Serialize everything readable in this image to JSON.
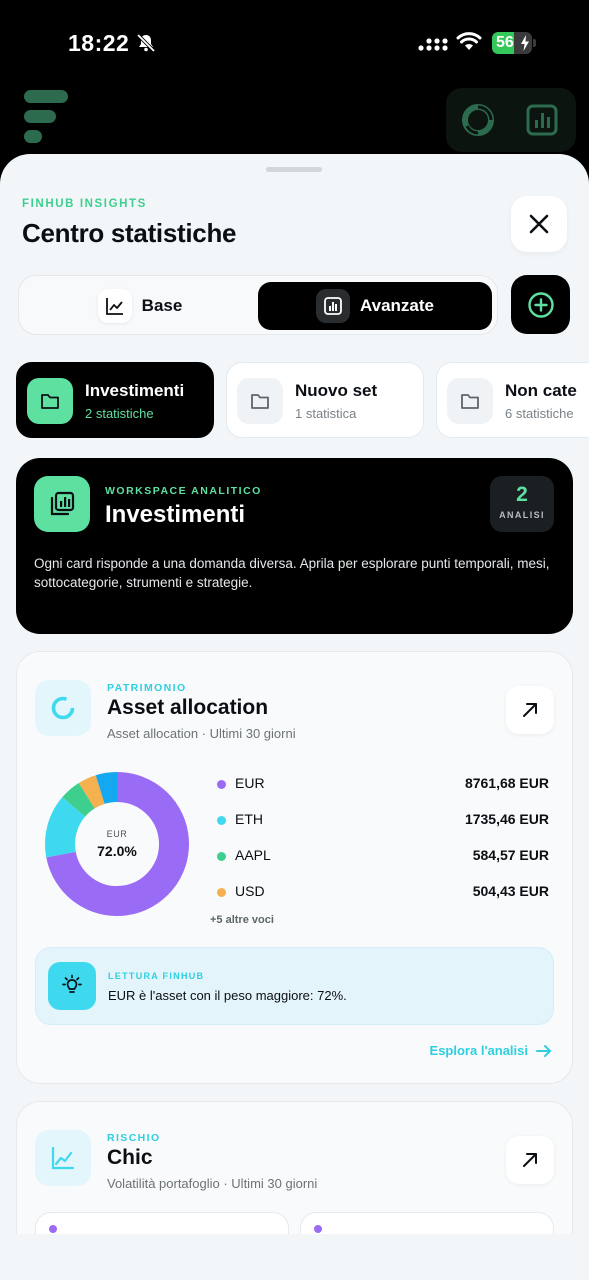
{
  "status_bar": {
    "time": "18:22",
    "battery": "56",
    "battery_level": 0.56
  },
  "header": {
    "eyebrow": "FINHUB INSIGHTS",
    "title": "Centro statistiche"
  },
  "mode_tabs": [
    {
      "label": "Base",
      "active": false
    },
    {
      "label": "Avanzate",
      "active": true
    }
  ],
  "sets": [
    {
      "name": "Investimenti",
      "count": "2 statistiche",
      "active": true
    },
    {
      "name": "Nuovo set",
      "count": "1 statistica",
      "active": false
    },
    {
      "name": "Non cate",
      "count": "6 statistiche",
      "active": false
    }
  ],
  "workspace": {
    "eyebrow": "WORKSPACE ANALITICO",
    "title": "Investimenti",
    "count": "2",
    "count_label": "ANALISI",
    "description": "Ogni card risponde a una domanda diversa. Aprila per esplorare punti temporali, mesi, sottocategorie, strumenti e strategie."
  },
  "asset_card": {
    "eyebrow": "PATRIMONIO",
    "title": "Asset allocation",
    "subtitle": "Asset allocation · Ultimi 30 giorni",
    "center_label": "EUR",
    "center_value": "72.0%",
    "legend": [
      {
        "name": "EUR",
        "value": "8761,68 EUR",
        "color": "#9a6bf5"
      },
      {
        "name": "ETH",
        "value": "1735,46 EUR",
        "color": "#3fd9ef"
      },
      {
        "name": "AAPL",
        "value": "584,57 EUR",
        "color": "#3ecf8e"
      },
      {
        "name": "USD",
        "value": "504,43 EUR",
        "color": "#f5b04f"
      }
    ],
    "more": "+5 altre voci",
    "insight_eyebrow": "LETTURA FINHUB",
    "insight_text": "EUR è l'asset con il peso maggiore: 72%.",
    "explore_label": "Esplora l'analisi"
  },
  "chart_data": {
    "type": "pie",
    "categories": [
      "EUR",
      "ETH",
      "AAPL",
      "USD",
      "Altro"
    ],
    "values": [
      8761.68,
      1735.46,
      584.57,
      504.43,
      580.0
    ],
    "colors": [
      "#9a6bf5",
      "#3fd9ef",
      "#3ecf8e",
      "#f5b04f",
      "#14a8f0"
    ]
  },
  "risk_card": {
    "eyebrow": "RISCHIO",
    "title": "Chic",
    "subtitle": "Volatilità portafoglio · Ultimi 30 giorni"
  },
  "colors": {
    "accent_green": "#5ee0a1",
    "accent_cyan": "#2fcfdf",
    "purple": "#9a6bf5"
  }
}
